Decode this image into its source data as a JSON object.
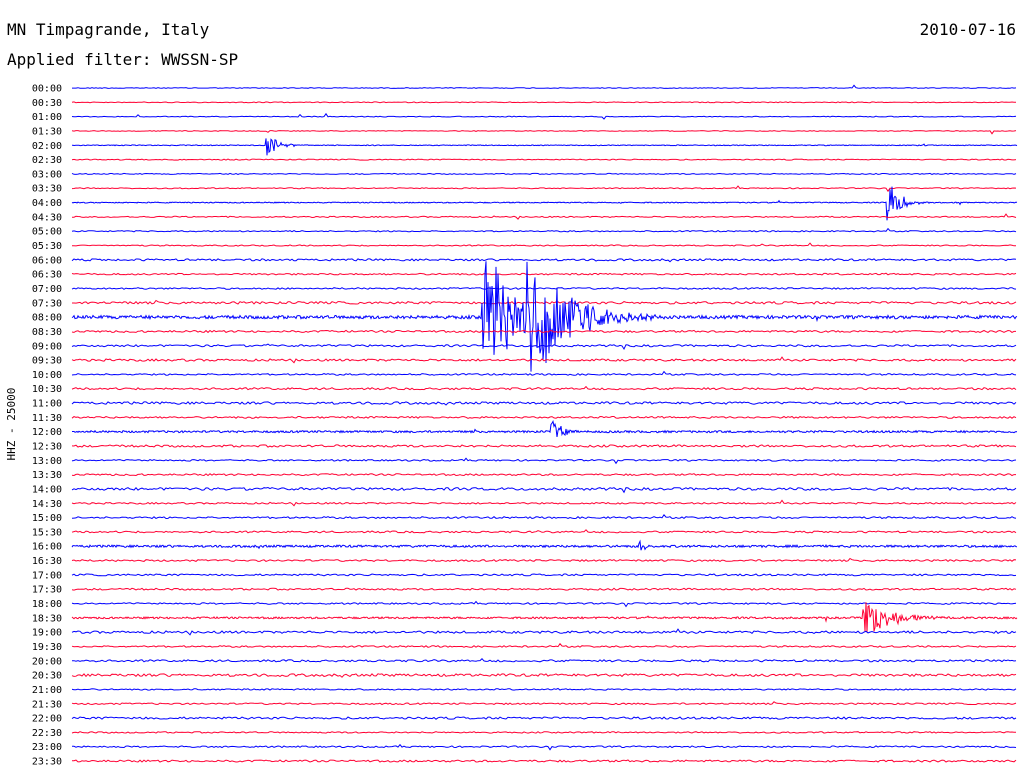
{
  "header": {
    "station": "MN Timpagrande, Italy",
    "date": "2010-07-16",
    "filter_label": "Applied filter: WWSSN-SP"
  },
  "channel_label": "HHZ - 25000",
  "colors": {
    "trace_blue": "#0000ff",
    "trace_red": "#ff0033",
    "text": "#000000",
    "background": "#ffffff"
  },
  "chart_data": {
    "type": "line",
    "title": "MN Timpagrande, Italy",
    "date": "2010-07-16",
    "filter": "WWSSN-SP",
    "channel": "HHZ - 25000",
    "row_interval_minutes": 30,
    "row_labels": [
      "00:00",
      "00:30",
      "01:00",
      "01:30",
      "02:00",
      "02:30",
      "03:00",
      "03:30",
      "04:00",
      "04:30",
      "05:00",
      "05:30",
      "06:00",
      "06:30",
      "07:00",
      "07:30",
      "08:00",
      "08:30",
      "09:00",
      "09:30",
      "10:00",
      "10:30",
      "11:00",
      "11:30",
      "12:00",
      "12:30",
      "13:00",
      "13:30",
      "14:00",
      "14:30",
      "15:00",
      "15:30",
      "16:00",
      "16:30",
      "17:00",
      "17:30",
      "18:00",
      "18:30",
      "19:00",
      "19:30",
      "20:00",
      "20:30",
      "21:00",
      "21:30",
      "22:00",
      "22:30",
      "23:00",
      "23:30"
    ],
    "row_colors": "alternating blue (hh:00) and red (hh:30)",
    "grid": false,
    "events": [
      {
        "row": "02:00",
        "at_fraction": 0.205,
        "amplitude_rows": 1.0,
        "duration_fraction": 0.05,
        "color": "blue"
      },
      {
        "row": "04:00",
        "at_fraction": 0.862,
        "amplitude_rows": 2.1,
        "duration_fraction": 0.05,
        "color": "blue"
      },
      {
        "row": "08:00",
        "at_fraction": 0.433,
        "amplitude_rows": 6.4,
        "duration_fraction": 0.12,
        "color": "blue"
      },
      {
        "row": "08:00",
        "at_fraction": 0.481,
        "amplitude_rows": 5.6,
        "duration_fraction": 0.16,
        "color": "blue"
      },
      {
        "row": "12:00",
        "at_fraction": 0.506,
        "amplitude_rows": 1.2,
        "duration_fraction": 0.04,
        "color": "blue"
      },
      {
        "row": "16:00",
        "at_fraction": 0.6,
        "amplitude_rows": 0.6,
        "duration_fraction": 0.03,
        "color": "blue"
      },
      {
        "row": "18:30",
        "at_fraction": 0.835,
        "amplitude_rows": 1.7,
        "duration_fraction": 0.12,
        "color": "red"
      }
    ]
  }
}
